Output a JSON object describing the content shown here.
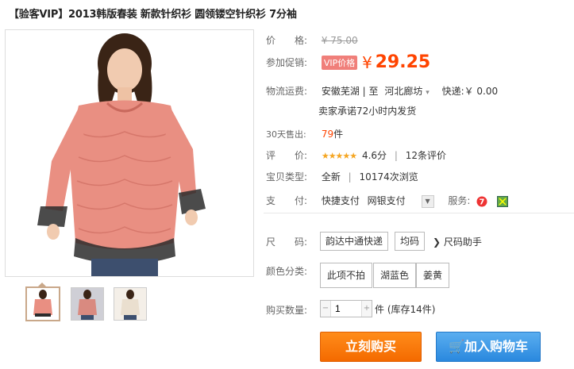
{
  "product": {
    "title": "【验客VIP】2013韩版春装 新款针织衫 圆领镂空针织衫 7分袖"
  },
  "price": {
    "label": "价　　格:",
    "original": "¥ 75.00",
    "promo_label": "参加促销:",
    "vip_badge": "VIP价格",
    "currency": "¥",
    "promo_value": "29.25"
  },
  "shipping": {
    "label": "物流运费:",
    "from": "安徽芜湖",
    "to_label": "| 至",
    "to": "河北廊坊",
    "express": "快递:￥ 0.00",
    "promise": "卖家承诺72小时内发货"
  },
  "sales": {
    "label": "30天售出:",
    "count": "79",
    "unit": "件"
  },
  "rating": {
    "label": "评　　价:",
    "stars": "★★★★★",
    "score": "4.6分",
    "reviews": "12条评价"
  },
  "type": {
    "label": "宝贝类型:",
    "value": "全新",
    "views": "10174次浏览"
  },
  "payment": {
    "label": "支　　付:",
    "method1": "快捷支付",
    "method2": "网银支付",
    "service_label": "服务:"
  },
  "options": {
    "size_label": "尺　　码:",
    "sizes": [
      "韵达中通快递",
      "均码"
    ],
    "size_helper": "尺码助手",
    "color_label": "颜色分类:",
    "colors": [
      "此项不拍",
      "湖蓝色",
      "姜黄"
    ]
  },
  "quantity": {
    "label": "购买数量:",
    "value": "1",
    "unit": "件",
    "stock": "(库存14件)"
  },
  "actions": {
    "buy_now": "立刻购买",
    "add_cart": "加入购物车"
  },
  "colors": {
    "accent": "#ff4400",
    "buy_button": "#f46a00",
    "cart_button": "#2a88de",
    "vip_badge": "#f07f7a"
  }
}
